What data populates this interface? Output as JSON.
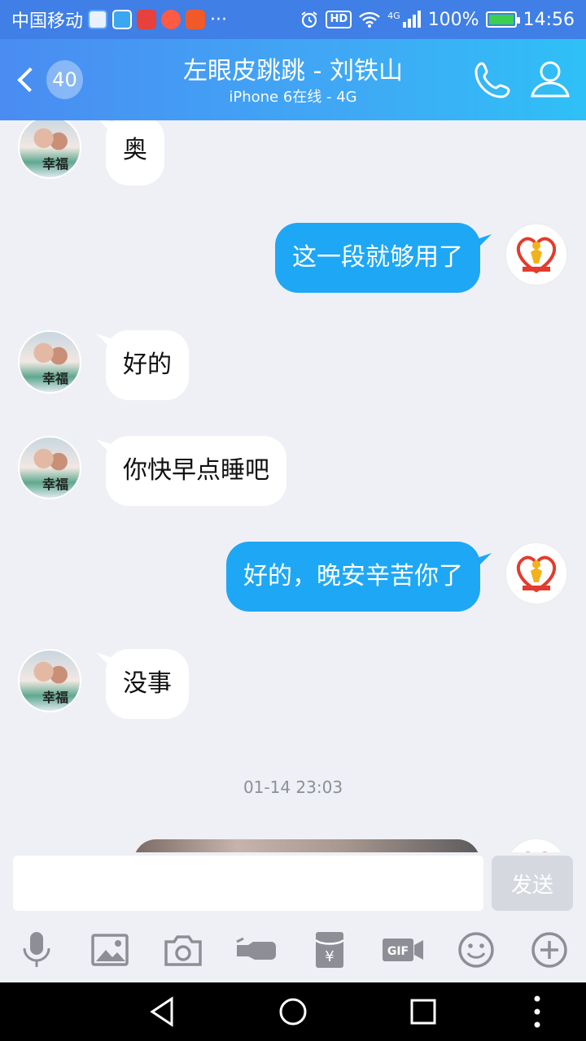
{
  "status_bar": {
    "carrier": "中国移动",
    "more": "···",
    "hd": "HD",
    "network": "4G",
    "battery": "100%",
    "time": "14:56"
  },
  "header": {
    "back_count": "40",
    "title": "左眼皮跳跳 - 刘铁山",
    "subtitle": "iPhone 6在线 - 4G"
  },
  "messages": [
    {
      "side": "in",
      "text": "奥"
    },
    {
      "side": "out",
      "text": "这一段就够用了"
    },
    {
      "side": "in",
      "text": "好的"
    },
    {
      "side": "in",
      "text": "你快早点睡吧"
    },
    {
      "side": "out",
      "text": "好的，晚安辛苦你了"
    },
    {
      "side": "in",
      "text": "没事"
    }
  ],
  "peer_avatar_text": "幸福",
  "timestamp": "01-14 23:03",
  "input": {
    "value": "",
    "send_label": "发送"
  },
  "toolbar": [
    "mic-icon",
    "image-icon",
    "camera-icon",
    "poke-icon",
    "red-packet-icon",
    "gif-icon",
    "emoji-icon",
    "plus-icon"
  ],
  "colors": {
    "header_start": "#4a8cf2",
    "header_end": "#2fc0f6",
    "out_bubble": "#1ea7f5",
    "in_bubble": "#ffffff",
    "background": "#eff0f5"
  }
}
